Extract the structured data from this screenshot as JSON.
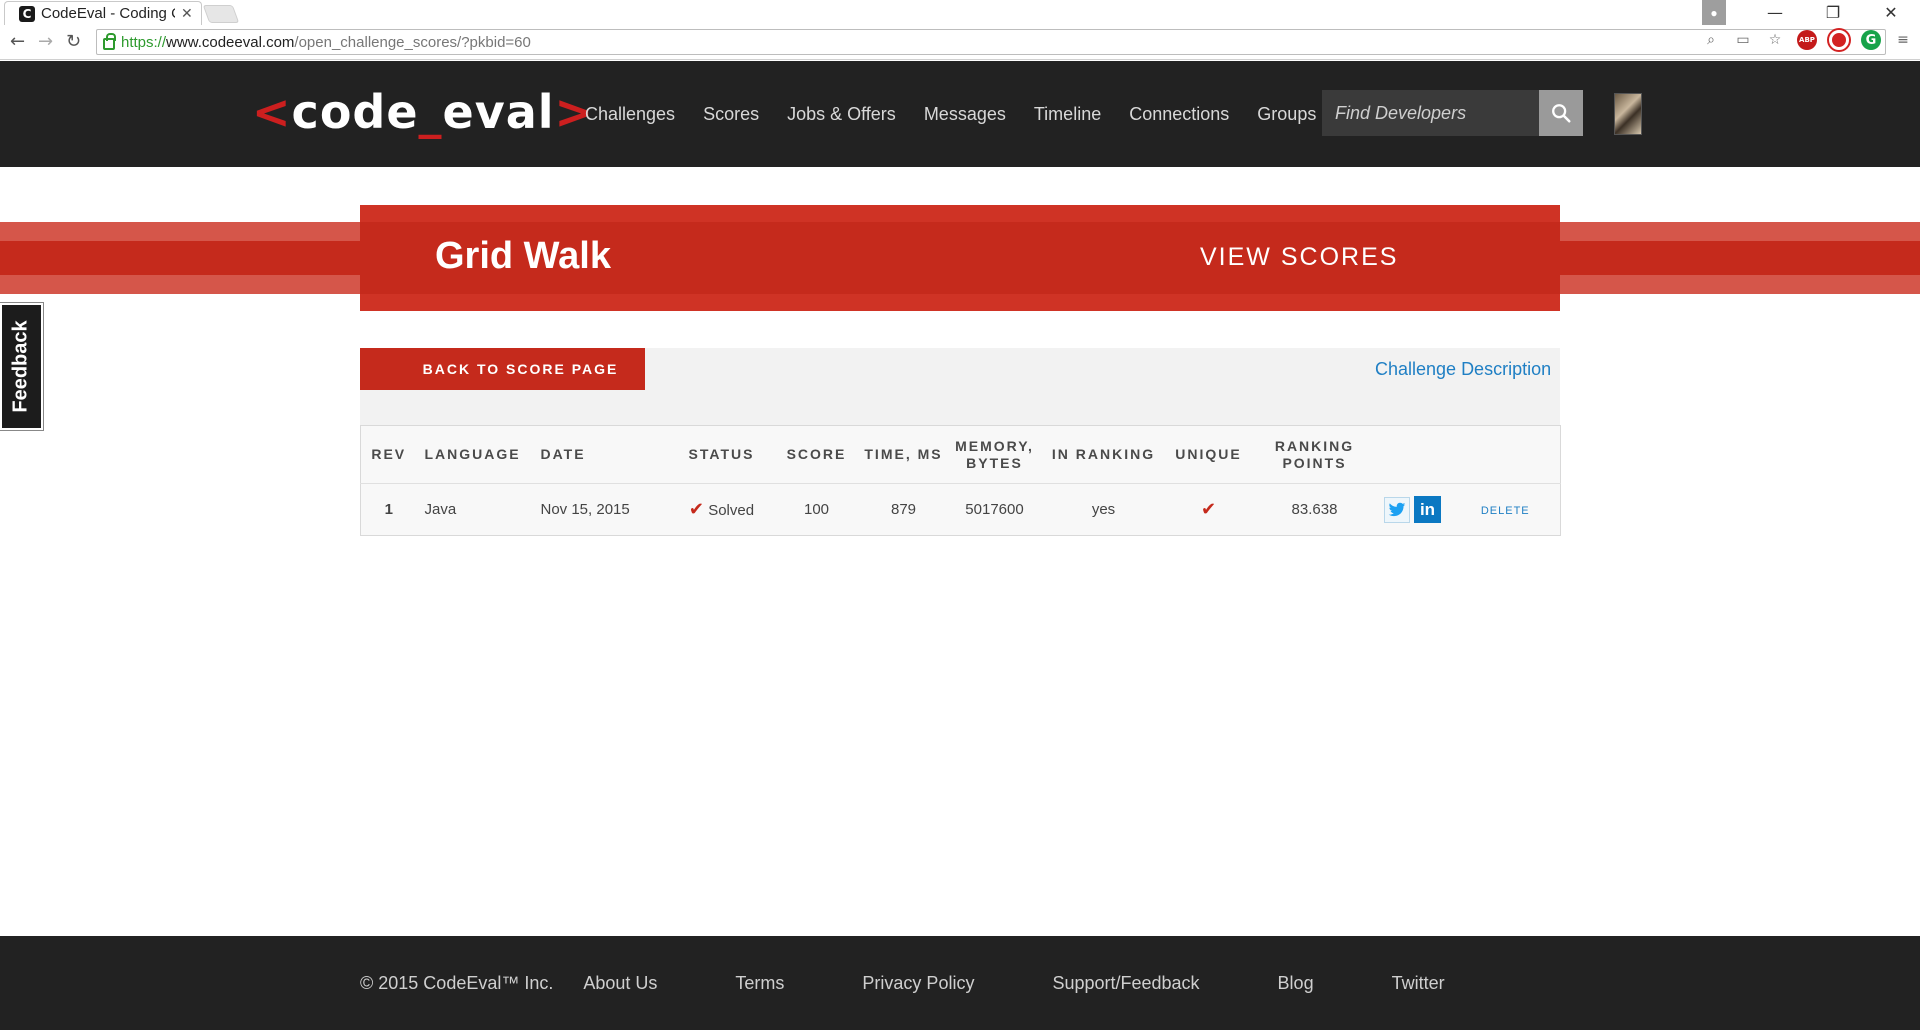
{
  "browser": {
    "tab_title": "CodeEval - Coding C",
    "tab_favicon": "C",
    "url_scheme": "https://",
    "url_host": "www.codeeval.com",
    "url_path": "/open_challenge_scores/?pkbid=60",
    "extension_abp_label": "ABP",
    "extension_grammarly_label": "G"
  },
  "site": {
    "logo": {
      "open": "<",
      "word_a": "code",
      "underscore": "_",
      "word_b": "eval",
      "close": ">"
    },
    "nav": [
      "Challenges",
      "Scores",
      "Jobs & Offers",
      "Messages",
      "Timeline",
      "Connections",
      "Groups"
    ],
    "search_placeholder": "Find Developers"
  },
  "hero": {
    "title": "Grid Walk",
    "link": "VIEW SCORES"
  },
  "feedback_label": "Feedback",
  "actions": {
    "back": "BACK TO SCORE PAGE",
    "description": "Challenge Description"
  },
  "table": {
    "headers": {
      "rev": "REV",
      "language": "LANGUAGE",
      "date": "DATE",
      "status": "STATUS",
      "score": "SCORE",
      "time": "TIME, MS",
      "memory": "MEMORY, BYTES",
      "in_ranking": "IN RANKING",
      "unique": "UNIQUE",
      "ranking_points": "RANKING POINTS"
    },
    "rows": [
      {
        "rev": "1",
        "language": "Java",
        "date": "Nov 15, 2015",
        "status": "Solved",
        "score": "100",
        "time": "879",
        "memory": "5017600",
        "in_ranking": "yes",
        "unique": true,
        "ranking_points": "83.638",
        "linkedin_label": "in",
        "delete": "DELETE"
      }
    ]
  },
  "footer": {
    "copyright": "© 2015 CodeEval™ Inc.",
    "links": [
      "About Us",
      "Terms",
      "Privacy Policy",
      "Support/Feedback",
      "Blog",
      "Twitter"
    ]
  },
  "colors": {
    "brand_red": "#c52a1c",
    "header_bg": "#222222",
    "link_blue": "#1f7fc4"
  }
}
